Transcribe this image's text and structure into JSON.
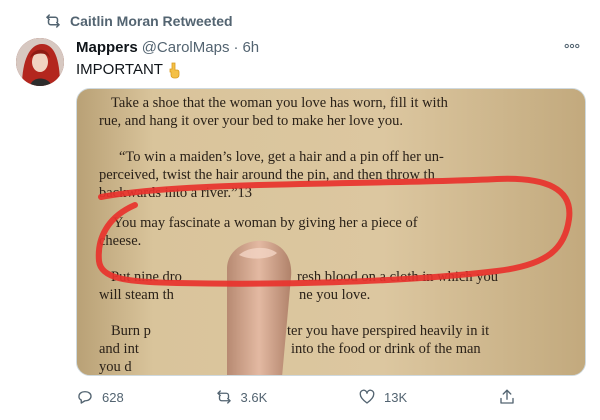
{
  "retweet": {
    "label": "Caitlin Moran Retweeted"
  },
  "tweet": {
    "name": "Mappers",
    "handle": "@CarolMaps",
    "dot": "·",
    "time": "6h",
    "text": "IMPORTANT"
  },
  "book": {
    "lines": [
      "Take a shoe that the woman you love has worn, fill it with",
      "rue, and hang it over your bed to make her love you.",
      "“To win a maiden’s love, get a hair and a pin off her un-",
      "perceived, twist the hair around the pin, and then throw th",
      "backwards into a river.”13",
      "You may fascinate a woman by giving her a piece of",
      "cheese.",
      "Put nine dro",
      "resh blood on a cloth in which you",
      "will steam th",
      "ne you love.",
      "Burn p",
      "ter you have perspired heavily in it",
      "and int",
      "into the food or drink of the man",
      "you d"
    ]
  },
  "actions": {
    "reply_count": "628",
    "retweet_count": "3.6K",
    "like_count": "13K"
  },
  "icons": {
    "retweet": "retweet-icon",
    "more": "more-icon",
    "emoji": "pointing-down-emoji-icon",
    "reply": "reply-icon",
    "like": "heart-icon",
    "share": "share-icon"
  },
  "colors": {
    "secondary_text": "#536471",
    "primary_text": "#0f1419",
    "highlight_circle": "#e8322c"
  }
}
